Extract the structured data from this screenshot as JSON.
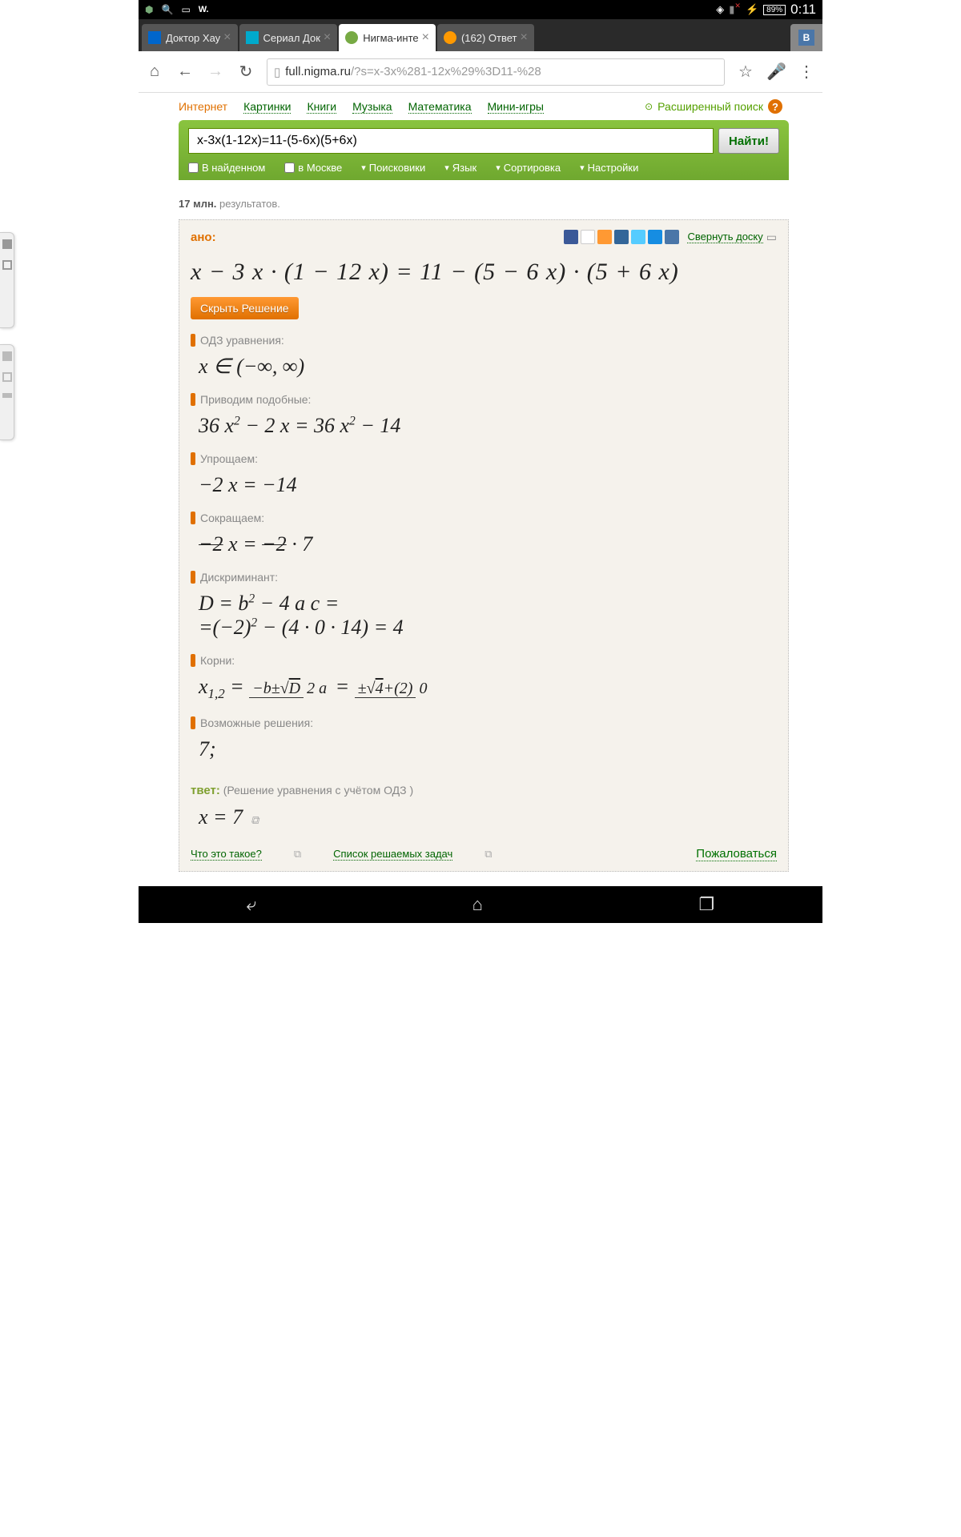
{
  "status": {
    "battery": "89%",
    "time": "0:11"
  },
  "tabs": [
    {
      "title": "Доктор Хау"
    },
    {
      "title": "Сериал Док"
    },
    {
      "title": "Нигма-инте",
      "active": true
    },
    {
      "title": "(162) Ответ"
    }
  ],
  "url": {
    "host": "full.nigma.ru",
    "query": "/?s=x-3x%281-12x%29%3D11-%28"
  },
  "nav": [
    "Интернет",
    "Картинки",
    "Книги",
    "Музыка",
    "Математика",
    "Мини-игры"
  ],
  "adv_search": "Расширенный поиск",
  "search": {
    "value": "x-3x(1-12x)=11-(5-6x)(5+6x)",
    "button": "Найти!"
  },
  "filters": {
    "found": "В найденном",
    "moscow": "в Москве",
    "engines": "Поисковики",
    "lang": "Язык",
    "sort": "Сортировка",
    "prefs": "Настройки"
  },
  "results": {
    "count": "17 млн.",
    "label": " результатов."
  },
  "board": {
    "given": "ано:",
    "collapse": "Свернуть доску",
    "equation": "x − 3 x · (1 − 12 x) = 11 − (5 − 6 x) · (5 + 6 x)",
    "hide": "Скрыть Решение",
    "steps": {
      "odz": {
        "label": "ОДЗ уравнения:",
        "math": "x ∈  (−∞, ∞)"
      },
      "like": {
        "label": "Приводим подобные:",
        "math": "36 x² − 2 x = 36 x² − 14"
      },
      "simplify": {
        "label": "Упрощаем:",
        "math": "−2 x = −14"
      },
      "reduce": {
        "label": "Сокращаем:"
      },
      "disc": {
        "label": "Дискриминант:"
      },
      "roots": {
        "label": "Корни:"
      },
      "possible": {
        "label": "Возможные решения:",
        "math": "7;"
      }
    },
    "answer": {
      "label": "твет:",
      "sub": " (Решение уравнения с учётом ОДЗ )",
      "math": "x = 7"
    },
    "footer": {
      "what": "Что это такое?",
      "list": "Список решаемых задач",
      "complain": "Пожаловаться"
    }
  }
}
